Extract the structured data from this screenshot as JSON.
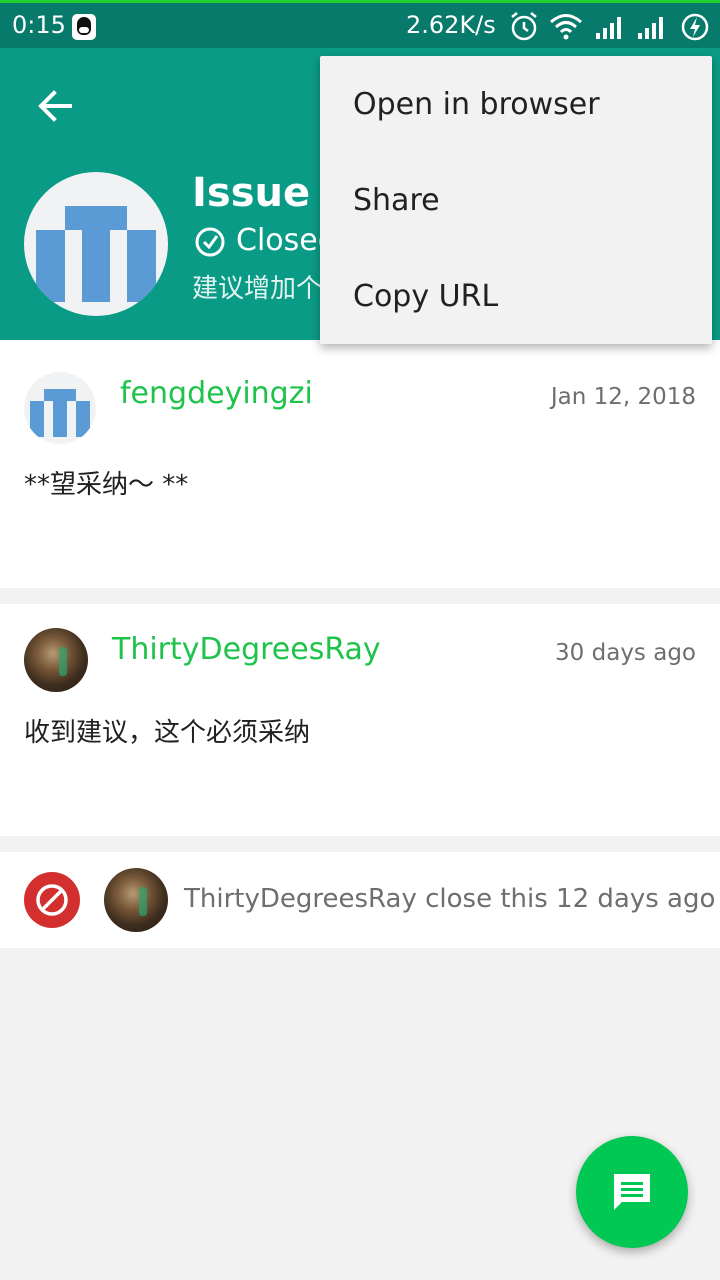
{
  "status_bar": {
    "time": "0:15",
    "net_speed": "2.62K/s",
    "icons": [
      "qq-icon",
      "alarm-icon",
      "wifi-icon",
      "signal-icon",
      "signal-icon",
      "battery-charging-icon"
    ]
  },
  "header": {
    "title": "Issue #",
    "state": "Closed",
    "subtitle": "建议增加个",
    "background_color": "#0a9b86"
  },
  "menu": {
    "items": [
      {
        "label": "Open in browser"
      },
      {
        "label": "Share"
      },
      {
        "label": "Copy URL"
      }
    ]
  },
  "comments": [
    {
      "author": "fengdeyingzi",
      "date": "Jan 12, 2018",
      "body": "**望采纳～ **"
    },
    {
      "author": "ThirtyDegreesRay",
      "date": "30 days ago",
      "body": "收到建议，这个必须采纳"
    }
  ],
  "events": [
    {
      "text": "ThirtyDegreesRay close this 12 days ago",
      "icon": "block-icon"
    }
  ],
  "fab": {
    "icon": "comment-icon"
  },
  "colors": {
    "accent": "#00c853",
    "author": "#1ec34a",
    "closed": "#d32f2f",
    "status_bar": "#077a6c"
  }
}
